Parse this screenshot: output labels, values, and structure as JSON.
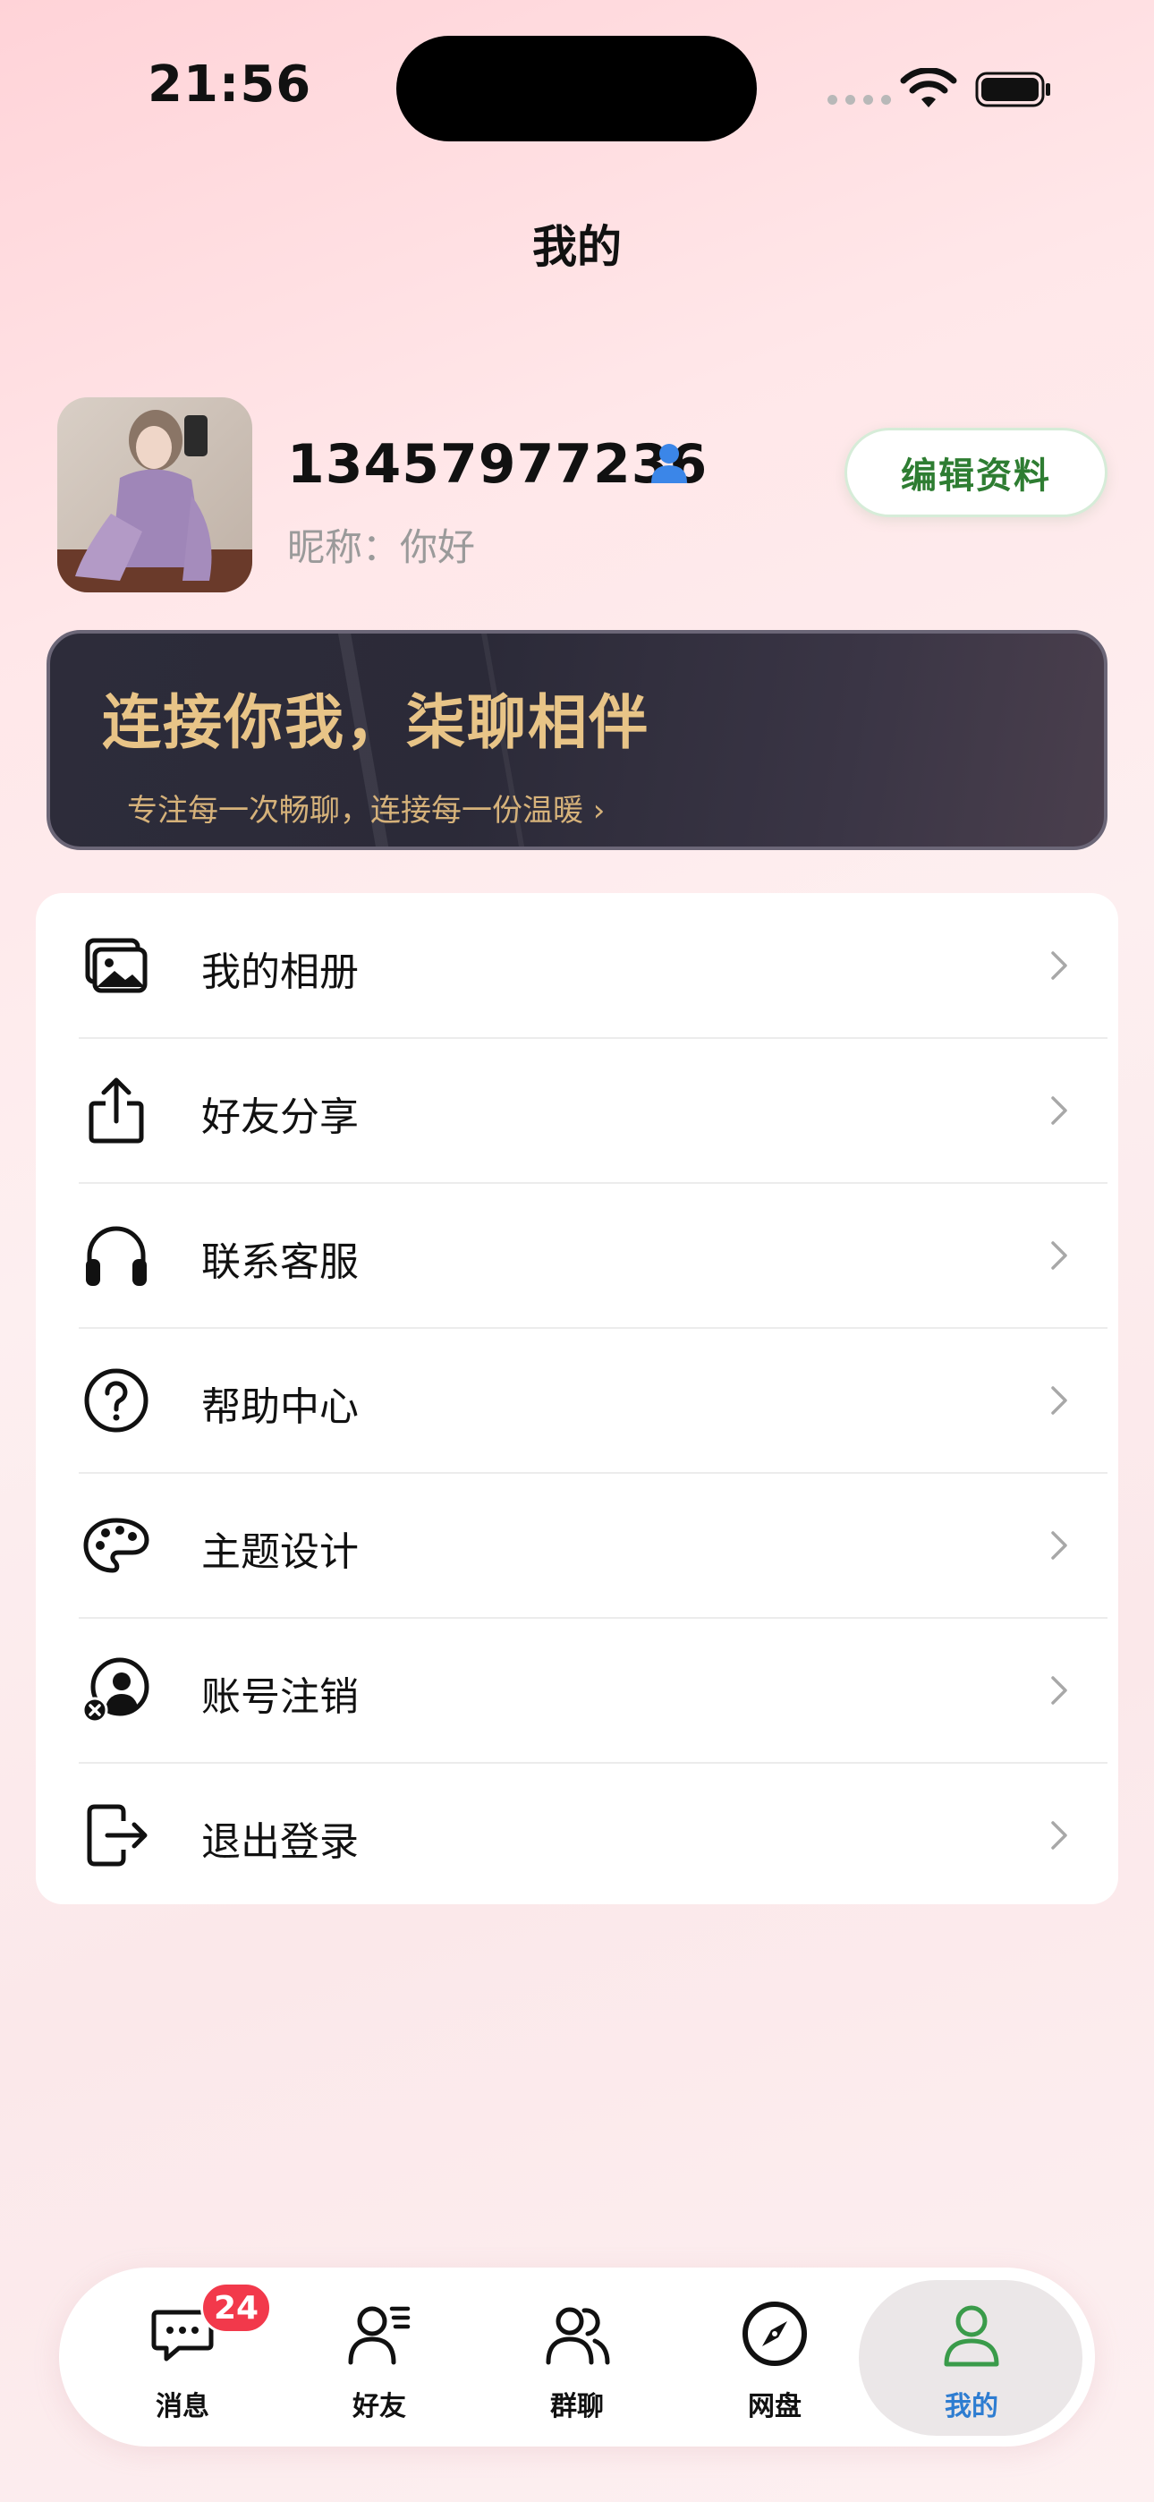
{
  "status_bar": {
    "time": "21:56"
  },
  "header": {
    "title": "我的"
  },
  "profile": {
    "phone": "13457977236",
    "nickname": "昵称：你好",
    "edit_label": "编辑资料"
  },
  "banner": {
    "title": "连接你我，柒聊相伴",
    "subtitle": "专注每一次畅聊，连接每一份温暖 ›"
  },
  "menu": {
    "items": [
      {
        "label": "我的相册",
        "icon": "album-icon"
      },
      {
        "label": "好友分享",
        "icon": "share-icon"
      },
      {
        "label": "联系客服",
        "icon": "headphones-icon"
      },
      {
        "label": "帮助中心",
        "icon": "help-icon"
      },
      {
        "label": "主题设计",
        "icon": "palette-icon"
      },
      {
        "label": "账号注销",
        "icon": "account-cancel-icon"
      },
      {
        "label": "退出登录",
        "icon": "logout-icon"
      }
    ]
  },
  "tabbar": {
    "tabs": [
      {
        "label": "消息",
        "icon": "message-icon"
      },
      {
        "label": "好友",
        "icon": "friends-icon"
      },
      {
        "label": "群聊",
        "icon": "group-chat-icon"
      },
      {
        "label": "网盘",
        "icon": "compass-icon"
      },
      {
        "label": "我的",
        "icon": "profile-icon",
        "active": true
      }
    ],
    "message_badge": "24"
  },
  "colors": {
    "accent_green": "#2e7d32",
    "active_tab": "#2e7dd1",
    "badge": "#f2394b",
    "banner_gold": "#e8c487"
  }
}
